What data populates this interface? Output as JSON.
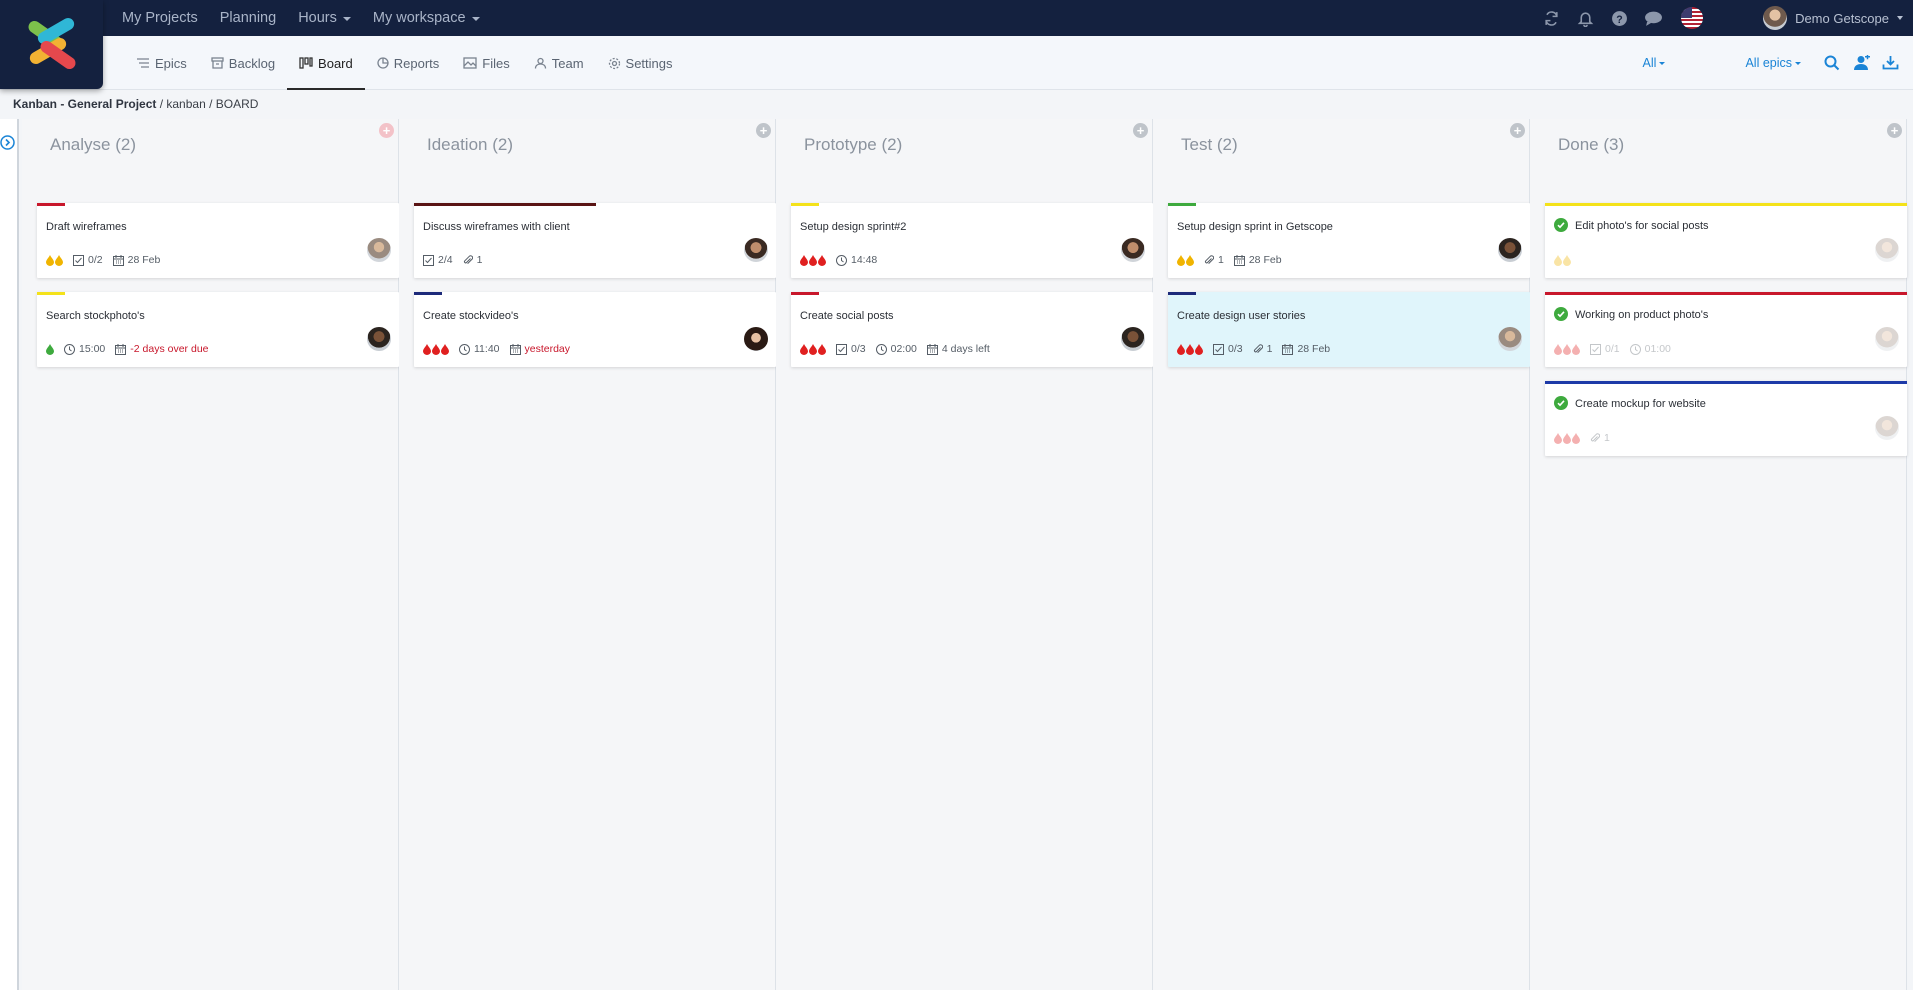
{
  "topnav": [
    {
      "label": "My Projects",
      "caret": false
    },
    {
      "label": "Planning",
      "caret": false
    },
    {
      "label": "Hours",
      "caret": true
    },
    {
      "label": "My workspace",
      "caret": true
    }
  ],
  "user": {
    "name": "Demo Getscope"
  },
  "subnav": {
    "epics": "Epics",
    "backlog": "Backlog",
    "board": "Board",
    "reports": "Reports",
    "files": "Files",
    "team": "Team",
    "settings": "Settings"
  },
  "filters": {
    "all": "All",
    "all_epics": "All epics"
  },
  "breadcrumb": {
    "project": "Kanban - General Project",
    "rest": " / kanban / BOARD"
  },
  "colors": {
    "accent": "#1a84d6",
    "navbar": "#14213f",
    "overdue": "#c8172b",
    "done": "#3eaa3e"
  },
  "columns": [
    {
      "title": "Analyse (2)",
      "add_pink": true,
      "cards": [
        {
          "title": "Draft wireframes",
          "bar": "#c8172b",
          "bar_w": 28,
          "priority": 2,
          "pcolor": "#f0b400",
          "meta": [
            {
              "icon": "checklist",
              "text": "0/2"
            },
            {
              "icon": "calendar",
              "text": "28 Feb"
            }
          ],
          "avatar": "grey"
        },
        {
          "title": "Search stockphoto's",
          "bar": "#f4e21a",
          "bar_w": 28,
          "priority": 1,
          "pcolor": "#3eaa3e",
          "meta": [
            {
              "icon": "clock",
              "text": "15:00"
            },
            {
              "icon": "calendar",
              "text": "-2 days over due",
              "red": true
            }
          ],
          "avatar": "dark"
        }
      ]
    },
    {
      "title": "Ideation (2)",
      "cards": [
        {
          "title": "Discuss wireframes with client",
          "bar": "#5a1414",
          "bar_w": 182,
          "priority": 0,
          "pcolor": "#e02020",
          "meta": [
            {
              "icon": "checklist",
              "text": "2/4"
            },
            {
              "icon": "paperclip",
              "text": "1"
            }
          ],
          "avatar": "brown"
        },
        {
          "title": "Create stockvideo's",
          "bar": "#1d2a7a",
          "bar_w": 28,
          "priority": 3,
          "pcolor": "#e02020",
          "meta": [
            {
              "icon": "clock",
              "text": "11:40"
            },
            {
              "icon": "calendar",
              "text": "yesterday",
              "red": true
            }
          ],
          "avatar": "woman"
        }
      ]
    },
    {
      "title": "Prototype (2)",
      "cards": [
        {
          "title": "Setup design sprint#2",
          "bar": "#f4e21a",
          "bar_w": 28,
          "priority": 3,
          "pcolor": "#e02020",
          "meta": [
            {
              "icon": "clock",
              "text": "14:48"
            }
          ],
          "avatar": "brown"
        },
        {
          "title": "Create social posts",
          "bar": "#c8172b",
          "bar_w": 28,
          "priority": 3,
          "pcolor": "#e02020",
          "meta": [
            {
              "icon": "checklist",
              "text": "0/3"
            },
            {
              "icon": "clock",
              "text": "02:00"
            },
            {
              "icon": "calendar",
              "text": "4 days left"
            }
          ],
          "avatar": "dark"
        }
      ]
    },
    {
      "title": "Test (2)",
      "cards": [
        {
          "title": "Setup design sprint in Getscope",
          "bar": "#3eaa3e",
          "bar_w": 28,
          "priority": 2,
          "pcolor": "#f0b400",
          "meta": [
            {
              "icon": "paperclip",
              "text": "1"
            },
            {
              "icon": "calendar",
              "text": "28 Feb"
            }
          ],
          "avatar": "dark"
        },
        {
          "title": "Create design user stories",
          "bar": "#1d2a7a",
          "bar_w": 28,
          "priority": 3,
          "pcolor": "#e02020",
          "highlight": true,
          "meta": [
            {
              "icon": "checklist",
              "text": "0/3"
            },
            {
              "icon": "paperclip",
              "text": "1"
            },
            {
              "icon": "calendar",
              "text": "28 Feb"
            }
          ],
          "avatar": "grey"
        }
      ]
    },
    {
      "title": "Done (3)",
      "cards": [
        {
          "title": "Edit photo's for social posts",
          "bar": "#f4e21a",
          "bar_w": 362,
          "priority": 2,
          "pcolor": "#f0b400",
          "done": true,
          "meta": [],
          "avatar": "grey"
        },
        {
          "title": "Working on product photo's",
          "bar": "#c8172b",
          "bar_w": 362,
          "priority": 3,
          "pcolor": "#e02020",
          "done": true,
          "meta": [
            {
              "icon": "checklist",
              "text": "0/1"
            },
            {
              "icon": "clock",
              "text": "01:00"
            }
          ],
          "avatar": "grey"
        },
        {
          "title": "Create mockup for website",
          "bar": "#1d3aa8",
          "bar_w": 362,
          "priority": 3,
          "pcolor": "#e02020",
          "done": true,
          "meta": [
            {
              "icon": "paperclip",
              "text": "1"
            }
          ],
          "avatar": "grey"
        }
      ]
    }
  ]
}
